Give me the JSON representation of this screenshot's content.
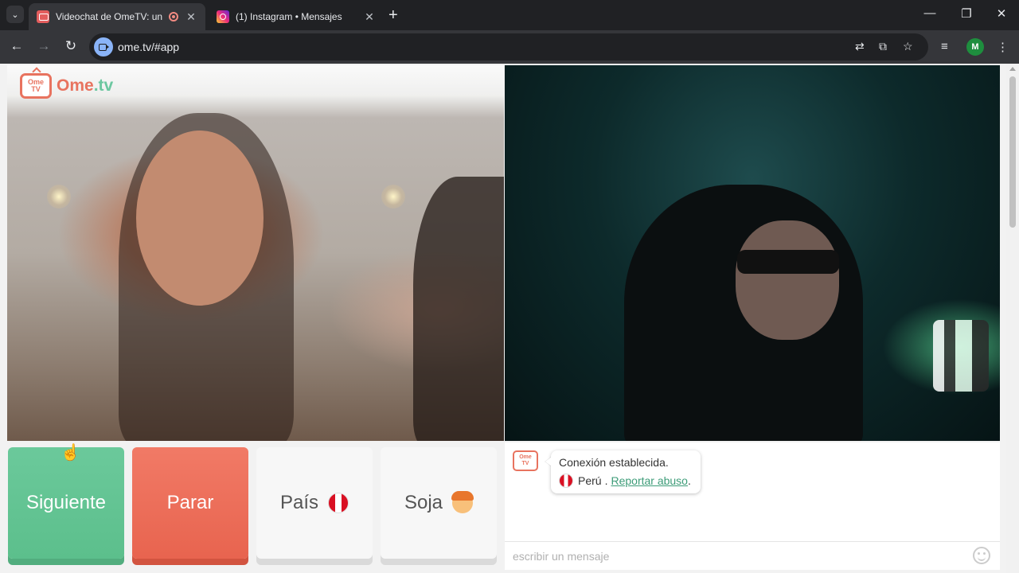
{
  "browser": {
    "tabs": [
      {
        "title": "Videochat de OmeTV: una a",
        "active": true
      },
      {
        "title": "(1) Instagram • Mensajes",
        "active": false
      }
    ],
    "url": "ome.tv/#app",
    "profile_initial": "M",
    "icons": {
      "tab_search": "chevron-down-icon",
      "back": "arrow-left-icon",
      "forward": "arrow-right-icon",
      "reload": "reload-icon",
      "translate": "translate-icon",
      "install": "install-app-icon",
      "bookmark": "star-icon",
      "media": "media-control-icon",
      "menu": "kebab-menu-icon"
    },
    "glyphs": {
      "tab_search": "⌄",
      "close": "✕",
      "new_tab": "+",
      "minimize": "—",
      "restore": "❐",
      "window_close": "✕",
      "back": "←",
      "forward": "→",
      "reload": "↻",
      "translate": "⇄",
      "install": "⧉",
      "bookmark": "☆",
      "media": "≡",
      "menu": "⋮",
      "cursor": "☝"
    }
  },
  "app": {
    "logo": {
      "tv_line1": "Ome",
      "tv_line2": "TV",
      "name": "Ome",
      "suffix": ".tv"
    },
    "buttons": {
      "next": "Siguiente",
      "stop": "Parar",
      "country": "País",
      "gender": "Soja"
    },
    "chat": {
      "logo_line1": "Ome",
      "logo_line2": "TV",
      "status": "Conexión establecida.",
      "country": "Perú",
      "separator": ".",
      "report_link": "Reportar abuso",
      "end": ".",
      "input_placeholder": "escribir un mensaje"
    },
    "colors": {
      "next": "#5cbf8c",
      "stop": "#e8644f",
      "brand": "#e8735f",
      "link": "#3d9c78"
    }
  }
}
